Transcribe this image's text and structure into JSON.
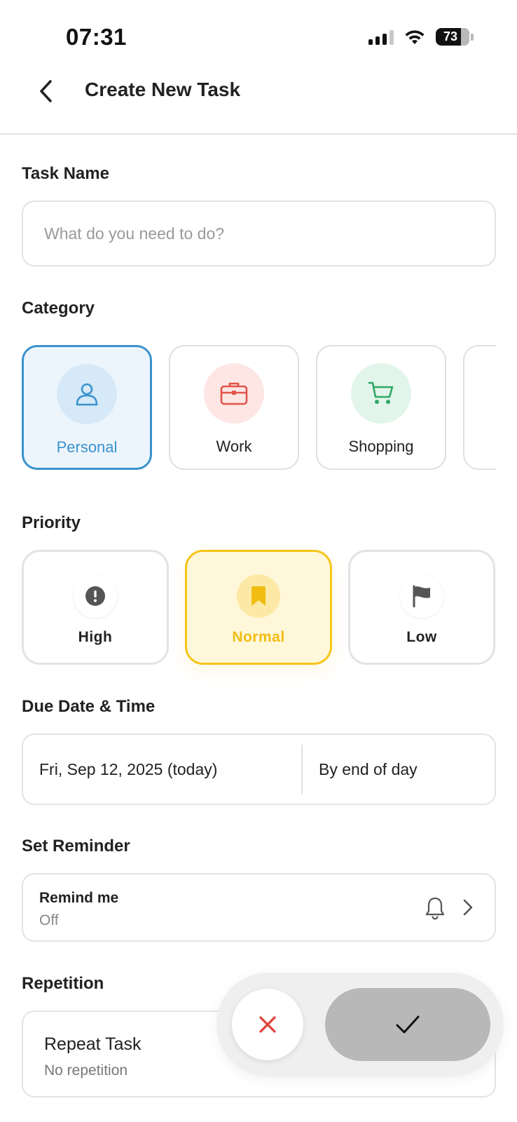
{
  "status_bar": {
    "time": "07:31",
    "battery_level": "73",
    "signal_icon": "cellular-signal-icon",
    "wifi_icon": "wifi-icon",
    "battery_icon": "battery-icon"
  },
  "header": {
    "title": "Create New Task",
    "back_icon": "chevron-left-icon"
  },
  "task_name": {
    "label": "Task Name",
    "value": "",
    "placeholder": "What do you need to do?"
  },
  "category": {
    "label": "Category",
    "selected": "Personal",
    "items": [
      {
        "label": "Personal",
        "icon": "person-icon",
        "icon_color": "#3a92cc",
        "icon_bg": "#d6e9f8"
      },
      {
        "label": "Work",
        "icon": "briefcase-icon",
        "icon_color": "#e0554a",
        "icon_bg": "#fde6e4"
      },
      {
        "label": "Shopping",
        "icon": "shopping-cart-icon",
        "icon_color": "#2fa865",
        "icon_bg": "#e2f5ea"
      }
    ]
  },
  "priority": {
    "label": "Priority",
    "selected": "Normal",
    "items": [
      {
        "label": "High",
        "icon": "exclamation-circle-icon"
      },
      {
        "label": "Normal",
        "icon": "bookmark-icon"
      },
      {
        "label": "Low",
        "icon": "flag-icon"
      }
    ],
    "accent_color": "#f5c518"
  },
  "due": {
    "label": "Due Date & Time",
    "date": "Fri, Sep 12, 2025 (today)",
    "time": "By end of day"
  },
  "reminder": {
    "label": "Set Reminder",
    "title": "Remind me",
    "value": "Off",
    "icon": "bell-icon",
    "chevron_icon": "chevron-right-icon"
  },
  "repetition": {
    "label": "Repetition",
    "title": "Repeat Task",
    "value": "No repetition"
  },
  "actions": {
    "cancel_icon": "close-icon",
    "cancel_color": "#e0403a",
    "confirm_icon": "check-icon"
  }
}
